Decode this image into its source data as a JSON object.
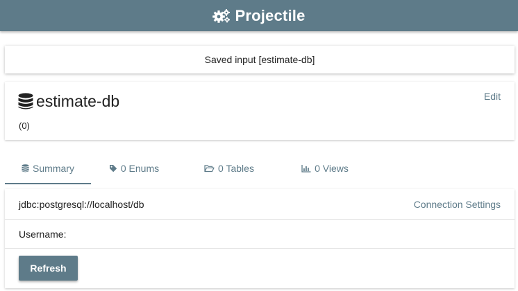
{
  "header": {
    "title": "Projectile",
    "icon": "cogs-icon"
  },
  "flash": {
    "message": "Saved input [estimate-db]"
  },
  "card": {
    "title": "estimate-db",
    "icon": "database-icon",
    "subtitle": "(0)",
    "edit_label": "Edit"
  },
  "tabs": [
    {
      "label": "Summary",
      "icon": "database-icon",
      "active": true
    },
    {
      "label": "0 Enums",
      "icon": "tag-icon",
      "active": false
    },
    {
      "label": "0 Tables",
      "icon": "folder-open-icon",
      "active": false
    },
    {
      "label": "0 Views",
      "icon": "bar-chart-icon",
      "active": false
    }
  ],
  "summary": {
    "url": "jdbc:postgresql://localhost/db",
    "connection_settings_label": "Connection Settings",
    "username_label": "Username:",
    "refresh_label": "Refresh"
  },
  "colors": {
    "accent": "#5e7b89",
    "header_bg": "#5e7b89",
    "text": "#222222"
  }
}
